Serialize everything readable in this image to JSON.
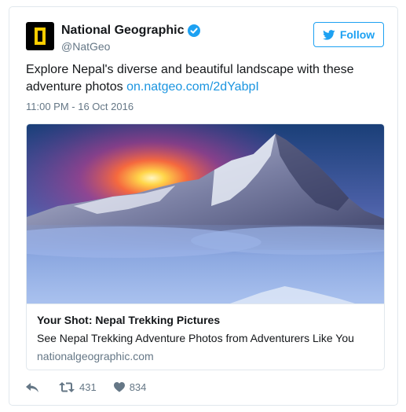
{
  "account": {
    "display_name": "National Geographic",
    "handle": "@NatGeo",
    "verified": true
  },
  "follow_button": {
    "label": "Follow"
  },
  "tweet": {
    "text": "Explore Nepal's diverse and beautiful landscape with these adventure photos ",
    "link_text": "on.natgeo.com/2dYabpI",
    "timestamp": "11:00 PM - 16 Oct 2016"
  },
  "card": {
    "title": "Your Shot: Nepal Trekking Pictures",
    "description": "See Nepal Trekking Adventure Photos from Adventurers Like You",
    "domain": "nationalgeographic.com"
  },
  "actions": {
    "retweet_count": "431",
    "like_count": "834"
  },
  "icons": {
    "brand": "natgeo-logo",
    "verified": "verified-badge-icon",
    "follow": "twitter-bird-icon",
    "reply": "reply-icon",
    "retweet": "retweet-icon",
    "like": "heart-icon"
  },
  "colors": {
    "accent": "#1da1f2",
    "link": "#1b95e0",
    "muted": "#657786",
    "border": "#e1e8ed",
    "logo_yellow": "#ffce00"
  }
}
